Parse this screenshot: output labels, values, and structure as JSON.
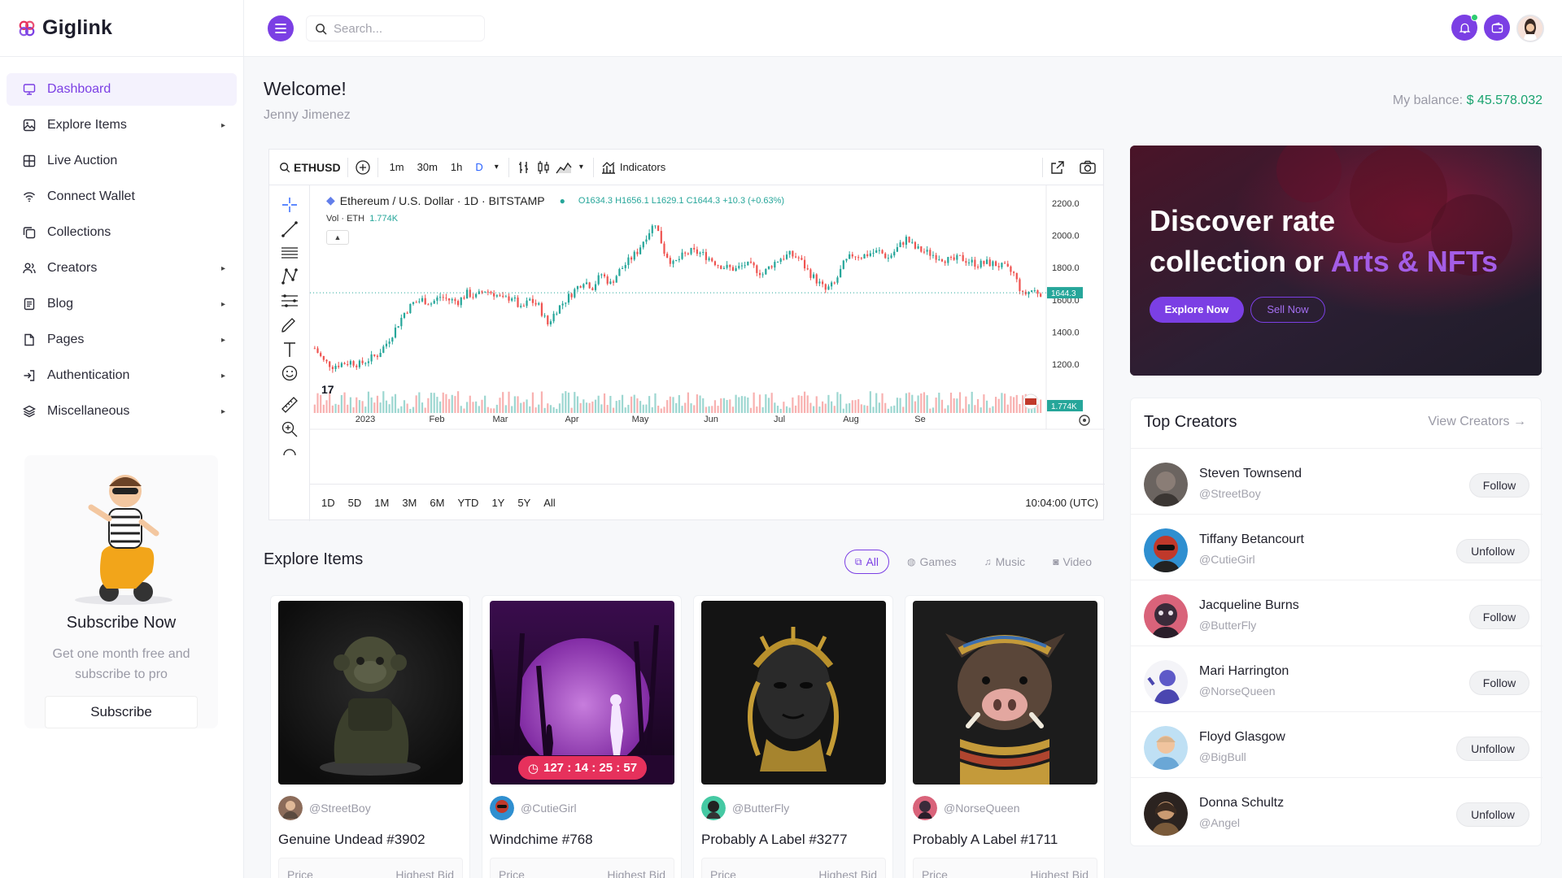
{
  "brand": {
    "name": "Giglink"
  },
  "sidebar": {
    "items": [
      {
        "label": "Dashboard",
        "icon": "monitor-icon",
        "active": true,
        "has_caret": false
      },
      {
        "label": "Explore Items",
        "icon": "image-icon",
        "active": false,
        "has_caret": true
      },
      {
        "label": "Live Auction",
        "icon": "grid-icon",
        "active": false,
        "has_caret": false
      },
      {
        "label": "Connect Wallet",
        "icon": "wifi-icon",
        "active": false,
        "has_caret": false
      },
      {
        "label": "Collections",
        "icon": "copy-icon",
        "active": false,
        "has_caret": false
      },
      {
        "label": "Creators",
        "icon": "users-icon",
        "active": false,
        "has_caret": true
      },
      {
        "label": "Blog",
        "icon": "document-icon",
        "active": false,
        "has_caret": true
      },
      {
        "label": "Pages",
        "icon": "file-icon",
        "active": false,
        "has_caret": true
      },
      {
        "label": "Authentication",
        "icon": "login-icon",
        "active": false,
        "has_caret": true
      },
      {
        "label": "Miscellaneous",
        "icon": "layers-icon",
        "active": false,
        "has_caret": true
      }
    ],
    "promo": {
      "title": "Subscribe Now",
      "text": "Get one month free and subscribe to pro",
      "button": "Subscribe"
    }
  },
  "header": {
    "search_placeholder": "Search..."
  },
  "welcome": {
    "title": "Welcome!",
    "name": "Jenny Jimenez"
  },
  "balance": {
    "label": "My balance:",
    "value": "$ 45.578.032"
  },
  "chart_toolbar": {
    "symbol": "ETHUSD",
    "intervals": [
      "1m",
      "30m",
      "1h",
      "D"
    ],
    "active_interval": "D",
    "indicators_label": "Indicators"
  },
  "chart_data": {
    "type": "candlestick",
    "title": "Ethereum / U.S. Dollar · 1D · BITSTAMP",
    "ohlc": {
      "open": "O1634.3",
      "high": "H1656.1",
      "low": "L1629.1",
      "close": "C1644.3",
      "change": "+10.3 (+0.63%)"
    },
    "volume_label": "Vol · ETH",
    "volume_value": "1.774K",
    "last_price_label": "1644.3",
    "last_volume_label": "1.774K",
    "last_price": 1644.3,
    "ylim": [
      1100,
      2250
    ],
    "y_ticks": [
      "2200.0",
      "2000.0",
      "1800.0",
      "1600.0",
      "1400.0",
      "1200.0"
    ],
    "x_ticks": [
      "2023",
      "Feb",
      "Mar",
      "Apr",
      "May",
      "Jun",
      "Jul",
      "Aug",
      "Se"
    ],
    "range_buttons": [
      "1D",
      "5D",
      "1M",
      "3M",
      "6M",
      "YTD",
      "1Y",
      "5Y",
      "All"
    ],
    "timestamp": "10:04:00 (UTC)",
    "close_path": [
      1300,
      1220,
      1190,
      1205,
      1215,
      1200,
      1230,
      1260,
      1330,
      1420,
      1520,
      1580,
      1600,
      1580,
      1620,
      1600,
      1590,
      1640,
      1620,
      1660,
      1640,
      1600,
      1620,
      1540,
      1600,
      1560,
      1450,
      1540,
      1600,
      1660,
      1720,
      1680,
      1760,
      1700,
      1780,
      1840,
      1900,
      2000,
      2080,
      1900,
      1820,
      1870,
      1900,
      1890,
      1860,
      1820,
      1800,
      1790,
      1820,
      1800,
      1760,
      1820,
      1860,
      1880,
      1860,
      1780,
      1720,
      1660,
      1700,
      1820,
      1880,
      1870,
      1890,
      1900,
      1860,
      1920,
      1980,
      1920,
      1900,
      1880,
      1860,
      1840,
      1860,
      1840,
      1820,
      1830,
      1820,
      1800,
      1760,
      1630,
      1660,
      1644
    ]
  },
  "explore": {
    "title": "Explore Items",
    "filters": [
      "All",
      "Games",
      "Music",
      "Video"
    ],
    "active_filter": "All",
    "cards": [
      {
        "owner": "@StreetBoy",
        "title": "Genuine Undead #3902",
        "price_label": "Price",
        "bid_label": "Highest Bid",
        "timer": ""
      },
      {
        "owner": "@CutieGirl",
        "title": "Windchime #768",
        "price_label": "Price",
        "bid_label": "Highest Bid",
        "timer": "127 : 14 : 25 : 57"
      },
      {
        "owner": "@ButterFly",
        "title": "Probably A Label #3277",
        "price_label": "Price",
        "bid_label": "Highest Bid",
        "timer": ""
      },
      {
        "owner": "@NorseQueen",
        "title": "Probably A Label #1711",
        "price_label": "Price",
        "bid_label": "Highest Bid",
        "timer": ""
      }
    ]
  },
  "hero": {
    "line1": "Discover rate",
    "line2": "collection or",
    "highlight": "Arts & NFTs",
    "primary_button": "Explore Now",
    "secondary_button": "Sell Now"
  },
  "creators": {
    "title": "Top Creators",
    "link": "View Creators →",
    "list": [
      {
        "name": "Steven Townsend",
        "handle": "@StreetBoy",
        "button": "Follow"
      },
      {
        "name": "Tiffany Betancourt",
        "handle": "@CutieGirl",
        "button": "Unfollow"
      },
      {
        "name": "Jacqueline Burns",
        "handle": "@ButterFly",
        "button": "Follow"
      },
      {
        "name": "Mari Harrington",
        "handle": "@NorseQueen",
        "button": "Follow"
      },
      {
        "name": "Floyd Glasgow",
        "handle": "@BigBull",
        "button": "Unfollow"
      },
      {
        "name": "Donna Schultz",
        "handle": "@Angel",
        "button": "Unfollow"
      }
    ]
  },
  "colors": {
    "accent": "#7b3fe4",
    "up": "#26a69a",
    "down": "#ef5350",
    "timer": "#e6315c"
  }
}
